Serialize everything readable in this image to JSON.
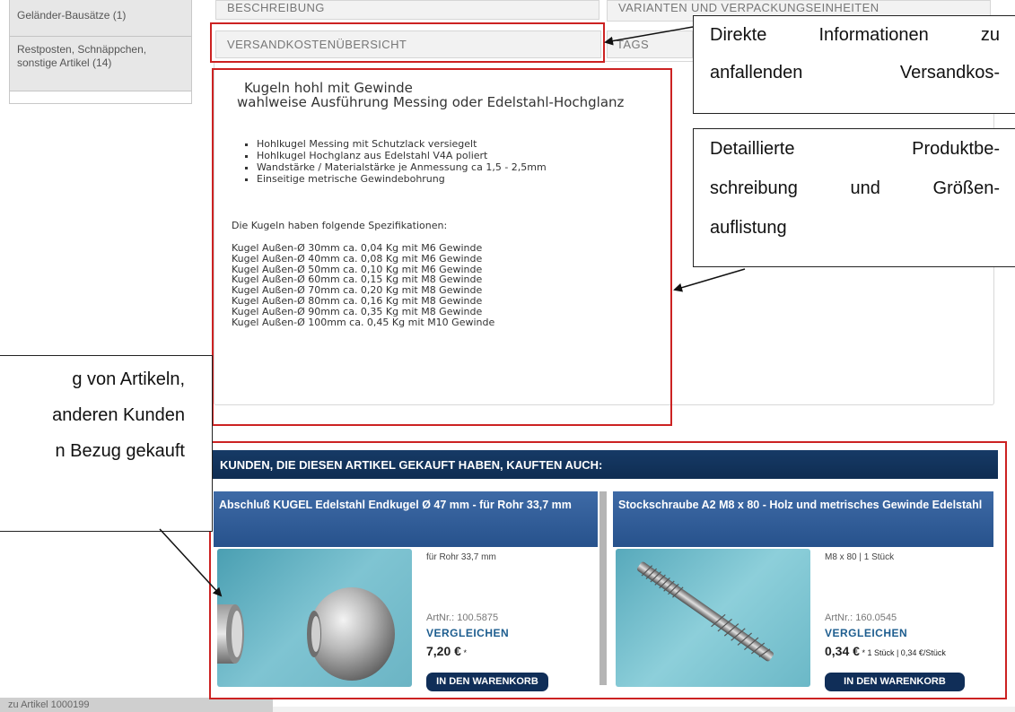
{
  "sidebar": {
    "items": [
      {
        "label": "Geländer-Bausätze (1)"
      },
      {
        "label": "Restposten, Schnäppchen, sonstige Artikel (14)"
      }
    ]
  },
  "tabs": {
    "beschreibung": "BESCHREIBUNG",
    "varianten": "VARIANTEN UND VERPACKUNGSEINHEITEN",
    "versandkosten": "VERSANDKOSTENÜBERSICHT",
    "tags": "TAGS"
  },
  "description": {
    "title_line1": "Kugeln hohl mit Gewinde",
    "title_line2": "wahlweise Ausführung Messing oder Edelstahl-Hochglanz",
    "bullets": [
      "Hohlkugel Messing mit Schutzlack versiegelt",
      "Hohlkugel Hochglanz aus Edelstahl V4A poliert",
      "Wandstärke / Materialstärke je Anmessung ca 1,5 - 2,5mm",
      "Einseitige metrische Gewindebohrung"
    ],
    "spec_title": "Die Kugeln haben folgende Spezifikationen:",
    "specs": [
      "Kugel Außen-Ø 30mm ca. 0,04 Kg mit M6 Gewinde",
      "Kugel Außen-Ø 40mm ca. 0,08 Kg mit M6 Gewinde",
      "Kugel Außen-Ø 50mm ca. 0,10 Kg mit M6 Gewinde",
      "Kugel Außen-Ø 60mm ca. 0,15 Kg mit M8 Gewinde",
      "Kugel Außen-Ø 70mm ca. 0,20 Kg mit M8 Gewinde",
      "Kugel Außen-Ø 80mm ca. 0,16 Kg mit M8 Gewinde",
      "Kugel Außen-Ø 90mm ca. 0,35 Kg mit M8 Gewinde",
      "Kugel Außen-Ø 100mm ca. 0,45 Kg mit M10 Gewinde"
    ]
  },
  "callouts": {
    "shipping": [
      "Direkte Informationen zu",
      "anfallenden Versandkos-"
    ],
    "description": [
      "Detaillierte Produktbe-",
      "schreibung und Größen-",
      "auflistung"
    ],
    "related": [
      "g von Artikeln,",
      "anderen Kunden",
      "n Bezug gekauft"
    ]
  },
  "recommendations": {
    "header": "KUNDEN, DIE DIESEN ARTIKEL GEKAUFT HABEN, KAUFTEN AUCH:",
    "products": [
      {
        "title": "Abschluß KUGEL Edelstahl Endkugel Ø 47 mm - für Rohr 33,7 mm",
        "subtitle": "für Rohr 33,7 mm",
        "artnr": "ArtNr.: 100.5875",
        "compare": "VERGLEICHEN",
        "price": "7,20 €",
        "price_suffix": " *",
        "unit_info": "",
        "cart": "IN DEN WARENKORB"
      },
      {
        "title": "Stockschraube A2 M8 x 80 - Holz und metrisches Gewinde Edelstahl",
        "subtitle": "M8 x 80 | 1 Stück",
        "artnr": "ArtNr.: 160.0545",
        "compare": "VERGLEICHEN",
        "price": "0,34 €",
        "price_suffix": " *",
        "unit_info": " 1 Stück | 0,34 €/Stück",
        "cart": "IN DEN WARENKORB"
      }
    ]
  },
  "footer": {
    "text": "zu Artikel 1000199"
  },
  "colors": {
    "highlight_border": "#cc2222",
    "header_navy": "#0f2d52",
    "title_blue": "#2d5a96"
  }
}
